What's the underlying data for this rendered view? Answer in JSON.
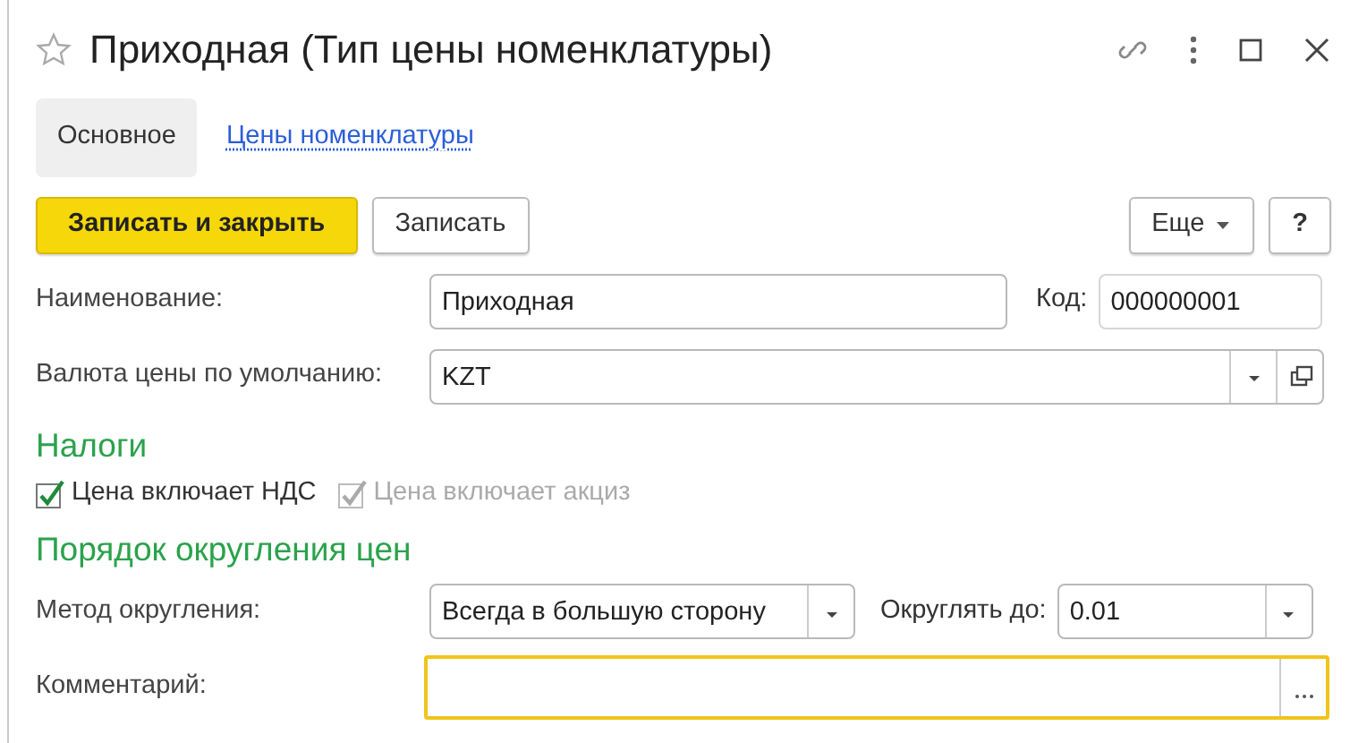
{
  "window": {
    "title": "Приходная (Тип цены номенклатуры)",
    "favorite": false
  },
  "tabs": [
    {
      "label": "Основное",
      "selected": true
    },
    {
      "label": "Цены номенклатуры",
      "selected": false
    }
  ],
  "toolbar": [
    {
      "label": "Записать и закрыть",
      "kind": "primary"
    },
    {
      "label": "Записать",
      "kind": "plain"
    },
    {
      "label": "Еще",
      "kind": "menu"
    },
    {
      "label": "?",
      "kind": "help"
    }
  ],
  "name_field": {
    "label": "Наименование:",
    "value": "Приходная"
  },
  "code_field": {
    "label": "Код:",
    "value": "000000001"
  },
  "currency_field": {
    "label": "Валюта цены по умолчанию:",
    "value": "KZT"
  },
  "taxes": {
    "heading": "Налоги",
    "checkboxes": [
      {
        "label": "Цена включает НДС",
        "checked": true,
        "disabled": false
      },
      {
        "label": "Цена включает акциз",
        "checked": true,
        "disabled": true
      }
    ]
  },
  "rounding": {
    "heading": "Порядок округления цен",
    "method": {
      "label": "Метод округления:",
      "value": "Всегда в большую сторону"
    },
    "precision": {
      "label": "Округлять до:",
      "value": "0.01"
    }
  },
  "comment_field": {
    "label": "Комментарий:",
    "focused": true
  }
}
